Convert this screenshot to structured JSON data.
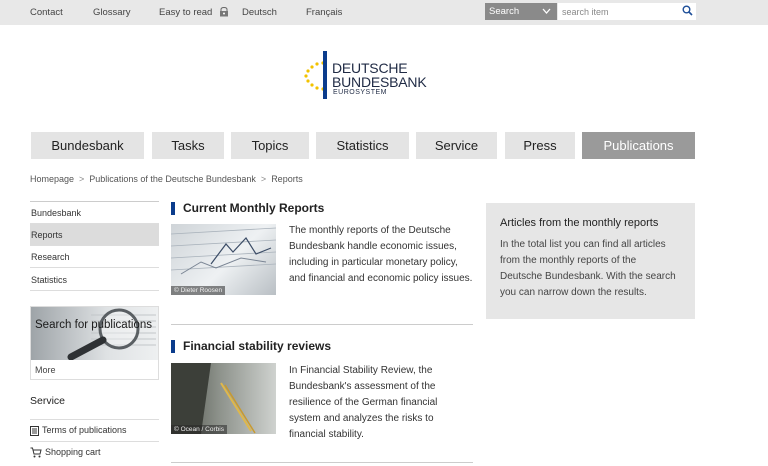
{
  "topbar": {
    "links": {
      "contact": "Contact",
      "glossary": "Glossary",
      "easy_to_read": "Easy to read",
      "deutsch": "Deutsch",
      "francais": "Français"
    },
    "search_select": "Search",
    "search_placeholder": "search item"
  },
  "logo": {
    "line1": "DEUTSCHE",
    "line2": "BUNDESBANK",
    "line3": "EUROSYSTEM"
  },
  "nav": {
    "bundesbank": "Bundesbank",
    "tasks": "Tasks",
    "topics": "Topics",
    "statistics": "Statistics",
    "service": "Service",
    "press": "Press",
    "publications": "Publications"
  },
  "breadcrumb": {
    "home": "Homepage",
    "publications": "Publications of the Deutsche Bundesbank",
    "reports": "Reports"
  },
  "sidebar": {
    "items": [
      "Bundesbank",
      "Reports",
      "Research",
      "Statistics"
    ],
    "search_publications": "Search for publications",
    "more": "More",
    "service_heading": "Service",
    "service_items": [
      "Terms of publications",
      "Shopping cart"
    ]
  },
  "articles": [
    {
      "title": "Current Monthly Reports",
      "credit": "© Dieter Roosen",
      "text": "The monthly reports of the Deutsche Bundesbank handle economic issues, including in particular monetary policy, and financial and economic policy issues."
    },
    {
      "title": "Financial stability reviews",
      "credit": "© Ocean / Corbis",
      "text": "In Financial Stability Review, the Bundesbank's assessment of the resilience of the German financial system and analyzes the risks to financial stability."
    }
  ],
  "infobox": {
    "title": "Articles from the monthly reports",
    "text": "In the total list you can find all articles from the monthly reports of the Deutsche Bundesbank. With the search you can narrow down the results."
  },
  "colors": {
    "brand_blue": "#0b3c8c",
    "logo_stars": "#f2c200",
    "active_tab": "#9a9a9a"
  }
}
